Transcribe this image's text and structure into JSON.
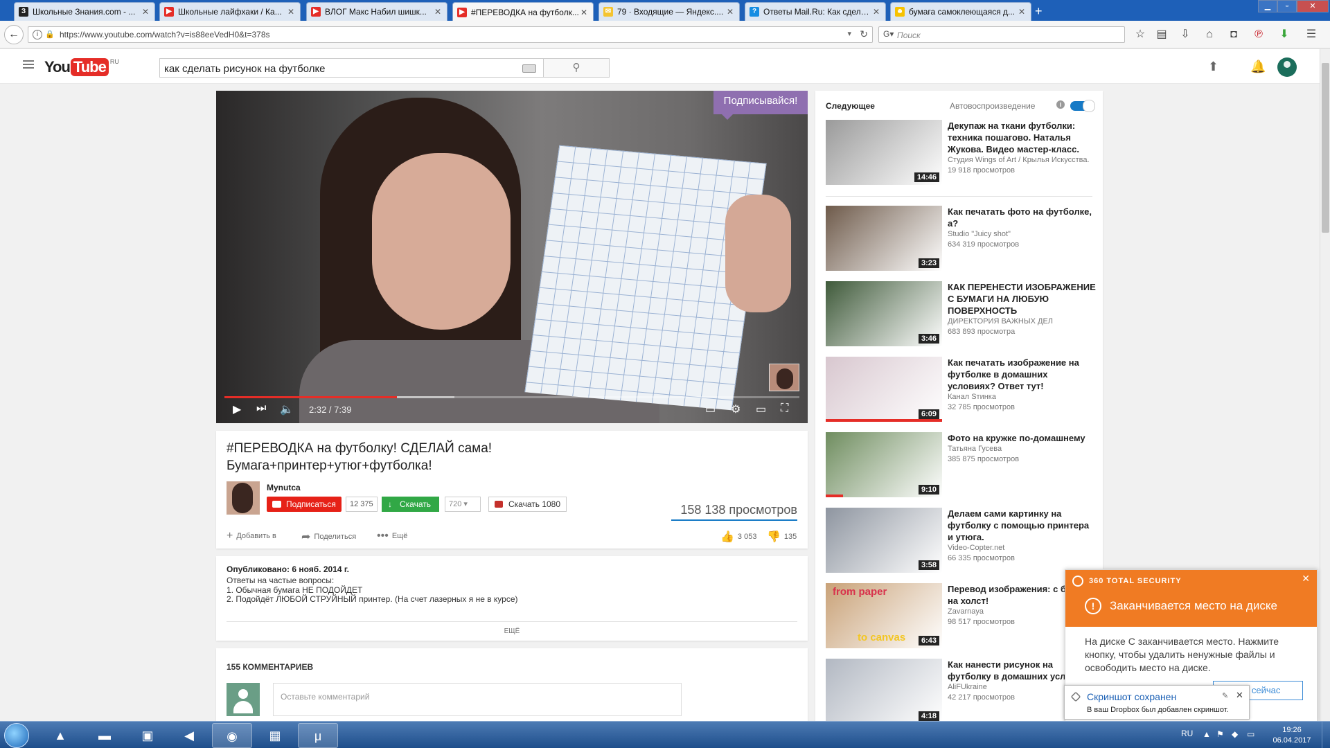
{
  "browser": {
    "tabs": [
      {
        "label": "Школьные Знания.com - ...",
        "favicon": "znanija-icon",
        "color": "#222222",
        "glyph": "З"
      },
      {
        "label": "Школьные лайфхаки / Ка...",
        "favicon": "youtube-icon",
        "color": "#e52d27",
        "glyph": "▶"
      },
      {
        "label": "ВЛОГ Макс Набил шишк...",
        "favicon": "youtube-icon",
        "color": "#e52d27",
        "glyph": "▶"
      },
      {
        "label": "#ПЕРЕВОДКА на футболк...",
        "favicon": "youtube-icon",
        "color": "#e52d27",
        "glyph": "▶",
        "active": true
      },
      {
        "label": "79 · Входящие — Яндекс....",
        "favicon": "yandex-mail-icon",
        "color": "#f4c430",
        "glyph": "✉"
      },
      {
        "label": "Ответы Mail.Ru: Как сдела...",
        "favicon": "mailru-answers-icon",
        "color": "#168de2",
        "glyph": "?"
      },
      {
        "label": "бумага самоклеющаяся д...",
        "favicon": "yandex-market-icon",
        "color": "#f7c200",
        "glyph": "☻"
      }
    ],
    "new_tab": "+",
    "url": "https://www.youtube.com/watch?v=is88eeVedH0&t=378s",
    "search_placeholder": "Поиск"
  },
  "youtube": {
    "logo_you": "You",
    "logo_tube": "Tube",
    "logo_region": "RU",
    "search_query": "как сделать рисунок на футболке",
    "player": {
      "overlay_subscribe": "Подписывайся!",
      "time": "2:32 / 7:39",
      "progress": 0.3,
      "loaded": 0.4
    },
    "video": {
      "title": "#ПЕРЕВОДКА на футболку! СДЕЛАЙ сама! Бумага+принтер+утюг+футболка!",
      "channel": "Mynutca",
      "subscribe": "Подписаться",
      "subscribers": "12 375",
      "download": "Скачать",
      "quality": "720 ▾",
      "download_1080": "Скачать 1080",
      "views": "158 138 просмотров",
      "add_to": "Добавить в",
      "share": "Поделиться",
      "more": "Ещё",
      "likes": "3 053",
      "dislikes": "135"
    },
    "description": {
      "published": "Опубликовано: 6 нояб. 2014 г.",
      "lines": [
        "Ответы на частые вопросы:",
        "1. Обычная бумага НЕ ПОДОЙДЕТ",
        "2. Подойдёт ЛЮБОЙ СТРУЙНЫЙ принтер. (На счет лазерных я не в курсе)"
      ],
      "show_more": "ЕЩЁ"
    },
    "comments": {
      "header": "155 КОММЕНТАРИЕВ",
      "placeholder": "Оставьте комментарий"
    },
    "sidebar": {
      "up_next": "Следующее",
      "autoplay": "Автовоспроизведение",
      "info": "i",
      "items": [
        {
          "title": "Декупаж на ткани футболки: техника пошагово. Наталья Жукова. Видео мастер-класс.",
          "author": "Студия Wings of Art / Крылья Искусства.",
          "views": "19 918 просмотров",
          "duration": "14:46",
          "thumb": "#9a9a9a",
          "watched": 0
        },
        {
          "title": "Как печатать фото на футболке, а?",
          "author": "Studio \"Juicy shot\"",
          "views": "634 319 просмотров",
          "duration": "3:23",
          "thumb": "#6e5a4a",
          "watched": 0
        },
        {
          "title": "КАК ПЕРЕНЕСТИ ИЗОБРАЖЕНИЕ С БУМАГИ НА ЛЮБУЮ ПОВЕРХНОСТЬ",
          "author": "ДИРЕКТОРИЯ ВАЖНЫХ ДЕЛ",
          "views": "683 893 просмотра",
          "duration": "3:46",
          "thumb": "#3f5a3a",
          "watched": 0
        },
        {
          "title": "Как печатать изображение на футболке в домашних условиях? Ответ тут!",
          "author": "Канал Sтинка",
          "views": "32 785 просмотров",
          "duration": "6:09",
          "thumb": "#d8c7cf",
          "watched": 1
        },
        {
          "title": "Фото на кружке по-домашнему",
          "author": "Татьяна Гусева",
          "views": "385 875 просмотров",
          "duration": "9:10",
          "thumb": "#6f8d5f",
          "watched": 0.15
        },
        {
          "title": "Делаем сами картинку на футболку с помощью принтера и утюга.",
          "author": "Video-Copter.net",
          "views": "66 335 просмотров",
          "duration": "3:58",
          "thumb": "#8e95a0",
          "watched": 0
        },
        {
          "title": "Перевод изображения: с бумаги на холст!",
          "author": "Zavarnaya",
          "views": "98 517 просмотров",
          "duration": "6:43",
          "thumb": "#c9a278",
          "watched": 0,
          "overlay_text": "from paper",
          "overlay_text2": "to canvas"
        },
        {
          "title": "Как нанести рисунок на футболку в домашних условиях",
          "author": "AliFUkraine",
          "views": "42 217 просмотров",
          "duration": "4:18",
          "thumb": "#b2b8c2",
          "watched": 0
        }
      ]
    }
  },
  "notification_360": {
    "brand": "360 TOTAL SECURITY",
    "heading": "Заканчивается место на диске",
    "body": "На диске C заканчивается место. Нажмите кнопку, чтобы удалить ненужные файлы и освободить место на диске.",
    "action": "ать сейчас"
  },
  "dropbox_toast": {
    "title": "Скриншот сохранен",
    "body": "В ваш Dropbox был добавлен скриншот."
  },
  "taskbar": {
    "language": "RU",
    "time": "19:26",
    "date": "06.04.2017"
  }
}
